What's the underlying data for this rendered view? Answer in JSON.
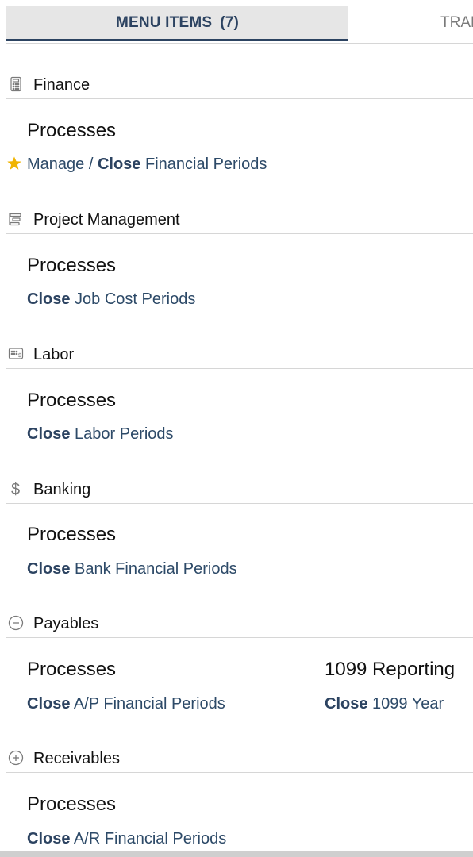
{
  "tabs": [
    {
      "label": "MENU ITEMS",
      "count": "(7)"
    },
    {
      "label": "TRAN"
    }
  ],
  "sections": [
    {
      "title": "Finance",
      "icon": "calculator-icon",
      "groups": [
        {
          "title": "Processes",
          "items": [
            {
              "pre": "Manage / ",
              "bold": "Close",
              "rest": " Financial Periods",
              "favorite": true
            }
          ]
        }
      ]
    },
    {
      "title": "Project Management",
      "icon": "gantt-icon",
      "groups": [
        {
          "title": "Processes",
          "items": [
            {
              "bold": "Close",
              "rest": " Job Cost Periods"
            }
          ]
        }
      ]
    },
    {
      "title": "Labor",
      "icon": "timecard-icon",
      "groups": [
        {
          "title": "Processes",
          "items": [
            {
              "bold": "Close",
              "rest": " Labor Periods"
            }
          ]
        }
      ]
    },
    {
      "title": "Banking",
      "icon": "dollar-icon",
      "groups": [
        {
          "title": "Processes",
          "items": [
            {
              "bold": "Close",
              "rest": " Bank Financial Periods"
            }
          ]
        }
      ]
    },
    {
      "title": "Payables",
      "icon": "minus-circle-icon",
      "groups": [
        {
          "title": "Processes",
          "items": [
            {
              "bold": "Close",
              "rest": " A/P Financial Periods"
            }
          ]
        },
        {
          "title": "1099 Reporting",
          "items": [
            {
              "bold": "Close",
              "rest": " 1099 Year"
            }
          ]
        }
      ]
    },
    {
      "title": "Receivables",
      "icon": "plus-circle-icon",
      "groups": [
        {
          "title": "Processes",
          "items": [
            {
              "bold": "Close",
              "rest": " A/R Financial Periods"
            }
          ]
        }
      ]
    }
  ],
  "colors": {
    "accent": "#2c4361",
    "link": "#2d4a68",
    "star": "#f0b400",
    "tab_bg": "#e6e6e6"
  }
}
